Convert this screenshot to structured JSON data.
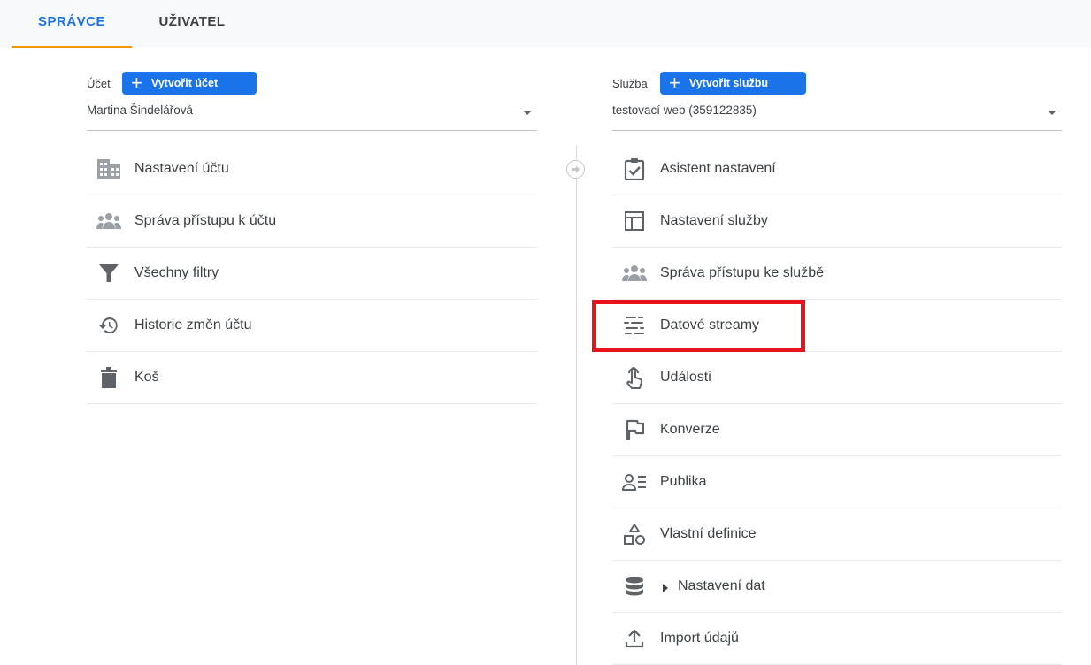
{
  "tabs": [
    {
      "label": "SPRÁVCE",
      "active": true
    },
    {
      "label": "UŽIVATEL",
      "active": false
    }
  ],
  "account": {
    "label": "Účet",
    "create_button": "Vytvořit účet",
    "selected": "Martina Šindelářová",
    "items": [
      {
        "label": "Nastavení účtu",
        "icon": "building-icon"
      },
      {
        "label": "Správa přístupu k účtu",
        "icon": "people-icon"
      },
      {
        "label": "Všechny filtry",
        "icon": "filter-icon"
      },
      {
        "label": "Historie změn účtu",
        "icon": "history-icon"
      },
      {
        "label": "Koš",
        "icon": "trash-icon"
      }
    ]
  },
  "property": {
    "label": "Služba",
    "create_button": "Vytvořit službu",
    "selected": "testovací web (359122835)",
    "items": [
      {
        "label": "Asistent nastavení",
        "icon": "clipboard-check-icon"
      },
      {
        "label": "Nastavení služby",
        "icon": "layout-icon"
      },
      {
        "label": "Správa přístupu ke službě",
        "icon": "people-icon"
      },
      {
        "label": "Datové streamy",
        "icon": "data-streams-icon",
        "highlighted": true
      },
      {
        "label": "Události",
        "icon": "touch-icon"
      },
      {
        "label": "Konverze",
        "icon": "flag-icon"
      },
      {
        "label": "Publika",
        "icon": "audience-icon"
      },
      {
        "label": "Vlastní definice",
        "icon": "shapes-icon"
      },
      {
        "label": "Nastavení dat",
        "icon": "database-icon",
        "expandable": true
      },
      {
        "label": "Import údajů",
        "icon": "upload-icon"
      }
    ]
  },
  "colors": {
    "accent": "#1a73e8",
    "tab_underline": "#f29900",
    "highlight": "#e8141c",
    "icon": "#5f6368"
  }
}
